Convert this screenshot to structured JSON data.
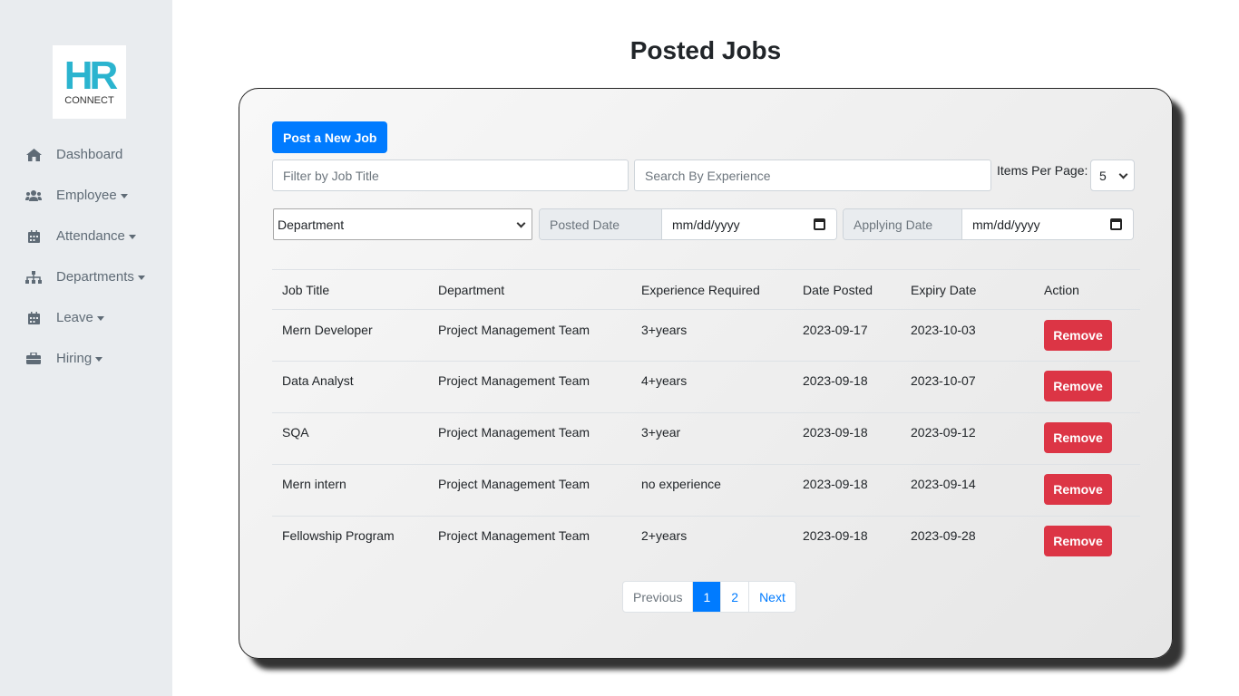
{
  "logo": {
    "top": "HR",
    "bottom": "CONNECT"
  },
  "sidebar": {
    "items": [
      {
        "label": "Dashboard",
        "icon": "home-icon",
        "caret": false
      },
      {
        "label": "Employee",
        "icon": "users-icon",
        "caret": true
      },
      {
        "label": "Attendance",
        "icon": "calendar-icon",
        "caret": true
      },
      {
        "label": "Departments",
        "icon": "sitemap-icon",
        "caret": true
      },
      {
        "label": "Leave",
        "icon": "calendar-icon",
        "caret": true
      },
      {
        "label": "Hiring",
        "icon": "briefcase-icon",
        "caret": true
      }
    ]
  },
  "page": {
    "title": "Posted Jobs"
  },
  "toolbar": {
    "post_label": "Post a New Job",
    "filter_title_placeholder": "Filter by Job Title",
    "search_experience_placeholder": "Search By Experience",
    "items_per_page_label": "Items Per Page:",
    "items_per_page_value": "5",
    "department_value": "Department",
    "posted_date_label": "Posted Date",
    "posted_date_value": "mm/dd/yyyy",
    "applying_date_label": "Applying Date",
    "applying_date_value": "mm/dd/yyyy"
  },
  "table": {
    "headers": [
      "Job Title",
      "Department",
      "Experience Required",
      "Date Posted",
      "Expiry Date",
      "Action"
    ],
    "rows": [
      {
        "title": "Mern Developer",
        "department": "Project Management Team",
        "experience": "3+years",
        "posted": "2023-09-17",
        "expiry": "2023-10-03",
        "action": "Remove"
      },
      {
        "title": "Data Analyst",
        "department": "Project Management Team",
        "experience": "4+years",
        "posted": "2023-09-18",
        "expiry": "2023-10-07",
        "action": "Remove"
      },
      {
        "title": "SQA",
        "department": "Project Management Team",
        "experience": "3+year",
        "posted": "2023-09-18",
        "expiry": "2023-09-12",
        "action": "Remove"
      },
      {
        "title": "Mern intern",
        "department": "Project Management Team",
        "experience": "no experience",
        "posted": "2023-09-18",
        "expiry": "2023-09-14",
        "action": "Remove"
      },
      {
        "title": "Fellowship Program",
        "department": "Project Management Team",
        "experience": "2+years",
        "posted": "2023-09-18",
        "expiry": "2023-09-28",
        "action": "Remove"
      }
    ]
  },
  "pagination": {
    "previous": "Previous",
    "pages": [
      "1",
      "2"
    ],
    "active": "1",
    "next": "Next"
  },
  "colors": {
    "primary": "#007bff",
    "danger": "#dc3545",
    "sidebar_bg": "#e9ecef",
    "logo": "#2bb4cf"
  }
}
